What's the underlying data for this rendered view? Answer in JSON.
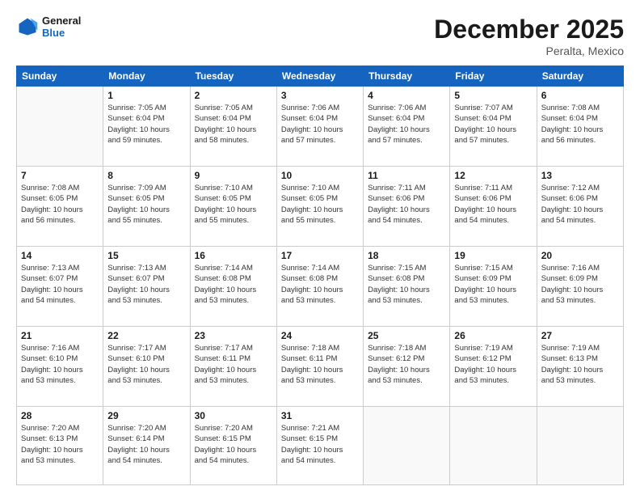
{
  "header": {
    "logo_general": "General",
    "logo_blue": "Blue",
    "month": "December 2025",
    "location": "Peralta, Mexico"
  },
  "weekdays": [
    "Sunday",
    "Monday",
    "Tuesday",
    "Wednesday",
    "Thursday",
    "Friday",
    "Saturday"
  ],
  "weeks": [
    [
      {
        "day": "",
        "info": ""
      },
      {
        "day": "1",
        "info": "Sunrise: 7:05 AM\nSunset: 6:04 PM\nDaylight: 10 hours\nand 59 minutes."
      },
      {
        "day": "2",
        "info": "Sunrise: 7:05 AM\nSunset: 6:04 PM\nDaylight: 10 hours\nand 58 minutes."
      },
      {
        "day": "3",
        "info": "Sunrise: 7:06 AM\nSunset: 6:04 PM\nDaylight: 10 hours\nand 57 minutes."
      },
      {
        "day": "4",
        "info": "Sunrise: 7:06 AM\nSunset: 6:04 PM\nDaylight: 10 hours\nand 57 minutes."
      },
      {
        "day": "5",
        "info": "Sunrise: 7:07 AM\nSunset: 6:04 PM\nDaylight: 10 hours\nand 57 minutes."
      },
      {
        "day": "6",
        "info": "Sunrise: 7:08 AM\nSunset: 6:04 PM\nDaylight: 10 hours\nand 56 minutes."
      }
    ],
    [
      {
        "day": "7",
        "info": "Sunrise: 7:08 AM\nSunset: 6:05 PM\nDaylight: 10 hours\nand 56 minutes."
      },
      {
        "day": "8",
        "info": "Sunrise: 7:09 AM\nSunset: 6:05 PM\nDaylight: 10 hours\nand 55 minutes."
      },
      {
        "day": "9",
        "info": "Sunrise: 7:10 AM\nSunset: 6:05 PM\nDaylight: 10 hours\nand 55 minutes."
      },
      {
        "day": "10",
        "info": "Sunrise: 7:10 AM\nSunset: 6:05 PM\nDaylight: 10 hours\nand 55 minutes."
      },
      {
        "day": "11",
        "info": "Sunrise: 7:11 AM\nSunset: 6:06 PM\nDaylight: 10 hours\nand 54 minutes."
      },
      {
        "day": "12",
        "info": "Sunrise: 7:11 AM\nSunset: 6:06 PM\nDaylight: 10 hours\nand 54 minutes."
      },
      {
        "day": "13",
        "info": "Sunrise: 7:12 AM\nSunset: 6:06 PM\nDaylight: 10 hours\nand 54 minutes."
      }
    ],
    [
      {
        "day": "14",
        "info": "Sunrise: 7:13 AM\nSunset: 6:07 PM\nDaylight: 10 hours\nand 54 minutes."
      },
      {
        "day": "15",
        "info": "Sunrise: 7:13 AM\nSunset: 6:07 PM\nDaylight: 10 hours\nand 53 minutes."
      },
      {
        "day": "16",
        "info": "Sunrise: 7:14 AM\nSunset: 6:08 PM\nDaylight: 10 hours\nand 53 minutes."
      },
      {
        "day": "17",
        "info": "Sunrise: 7:14 AM\nSunset: 6:08 PM\nDaylight: 10 hours\nand 53 minutes."
      },
      {
        "day": "18",
        "info": "Sunrise: 7:15 AM\nSunset: 6:08 PM\nDaylight: 10 hours\nand 53 minutes."
      },
      {
        "day": "19",
        "info": "Sunrise: 7:15 AM\nSunset: 6:09 PM\nDaylight: 10 hours\nand 53 minutes."
      },
      {
        "day": "20",
        "info": "Sunrise: 7:16 AM\nSunset: 6:09 PM\nDaylight: 10 hours\nand 53 minutes."
      }
    ],
    [
      {
        "day": "21",
        "info": "Sunrise: 7:16 AM\nSunset: 6:10 PM\nDaylight: 10 hours\nand 53 minutes."
      },
      {
        "day": "22",
        "info": "Sunrise: 7:17 AM\nSunset: 6:10 PM\nDaylight: 10 hours\nand 53 minutes."
      },
      {
        "day": "23",
        "info": "Sunrise: 7:17 AM\nSunset: 6:11 PM\nDaylight: 10 hours\nand 53 minutes."
      },
      {
        "day": "24",
        "info": "Sunrise: 7:18 AM\nSunset: 6:11 PM\nDaylight: 10 hours\nand 53 minutes."
      },
      {
        "day": "25",
        "info": "Sunrise: 7:18 AM\nSunset: 6:12 PM\nDaylight: 10 hours\nand 53 minutes."
      },
      {
        "day": "26",
        "info": "Sunrise: 7:19 AM\nSunset: 6:12 PM\nDaylight: 10 hours\nand 53 minutes."
      },
      {
        "day": "27",
        "info": "Sunrise: 7:19 AM\nSunset: 6:13 PM\nDaylight: 10 hours\nand 53 minutes."
      }
    ],
    [
      {
        "day": "28",
        "info": "Sunrise: 7:20 AM\nSunset: 6:13 PM\nDaylight: 10 hours\nand 53 minutes."
      },
      {
        "day": "29",
        "info": "Sunrise: 7:20 AM\nSunset: 6:14 PM\nDaylight: 10 hours\nand 54 minutes."
      },
      {
        "day": "30",
        "info": "Sunrise: 7:20 AM\nSunset: 6:15 PM\nDaylight: 10 hours\nand 54 minutes."
      },
      {
        "day": "31",
        "info": "Sunrise: 7:21 AM\nSunset: 6:15 PM\nDaylight: 10 hours\nand 54 minutes."
      },
      {
        "day": "",
        "info": ""
      },
      {
        "day": "",
        "info": ""
      },
      {
        "day": "",
        "info": ""
      }
    ]
  ]
}
